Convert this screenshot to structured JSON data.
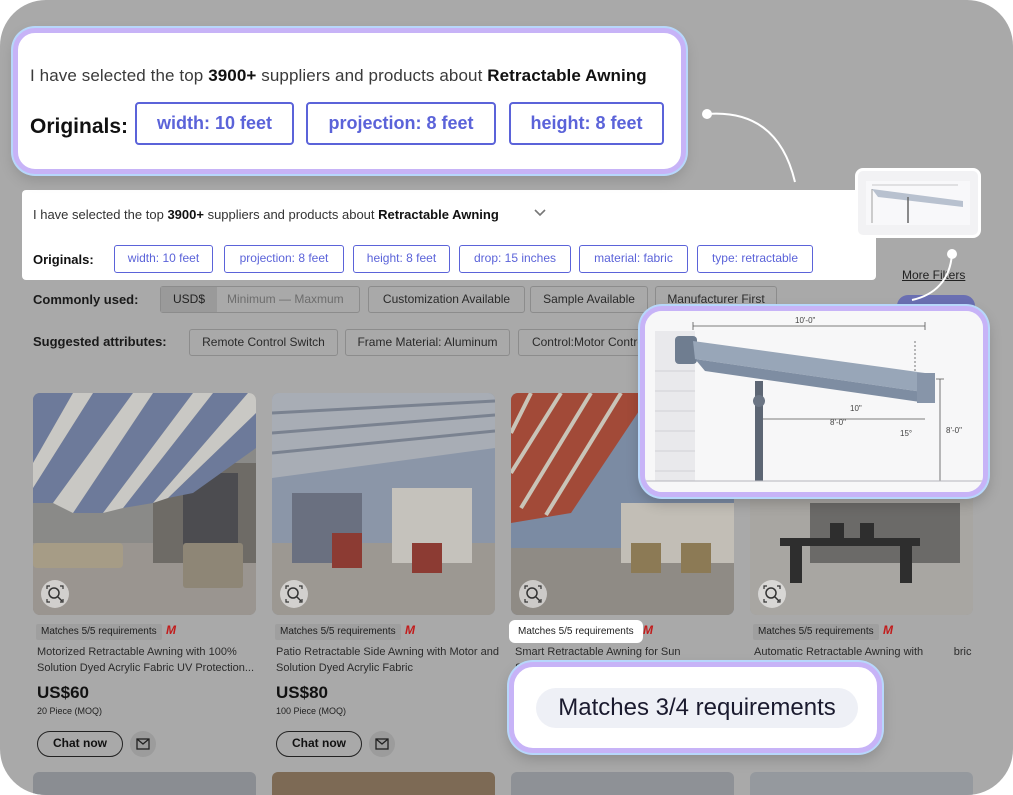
{
  "summary": {
    "prefix": "I have selected the top",
    "count": "3900+",
    "middle": "suppliers and products about",
    "query": "Retractable Awning"
  },
  "originals_label": "Originals:",
  "originals_top": [
    "width: 10 feet",
    "projection: 8 feet",
    "height: 8 feet"
  ],
  "originals_full": [
    "width: 10 feet",
    "projection: 8 feet",
    "height: 8 feet",
    "drop: 15 inches",
    "material: fabric",
    "type: retractable"
  ],
  "commonly_used": {
    "label": "Commonly used:",
    "currency": "USD$",
    "range_placeholder": "Minimum — Maxmum",
    "chips": [
      "Customization Available",
      "Sample Available",
      "Manufacturer First"
    ]
  },
  "suggested": {
    "label": "Suggested attributes:",
    "chips": [
      "Remote Control Switch",
      "Frame Material: Aluminum",
      "Control:Motor Contro"
    ]
  },
  "more_filters": "More Filters",
  "match_badge": "Matches 5/5 requirements",
  "match_callout": "Matches 3/4 requirements",
  "chat_label": "Chat now",
  "products": [
    {
      "title": "Motorized Retractable Awning with 100% Solution Dyed Acrylic Fabric UV Protection...",
      "price": "US$60",
      "moq": "20 Piece  (MOQ)"
    },
    {
      "title": "Patio Retractable Side Awning with Motor and Solution Dyed Acrylic Fabric",
      "price": "US$80",
      "moq": "100 Piece  (MOQ)"
    },
    {
      "title": "Smart Retractable Awning for Sun Shade S",
      "price": "",
      "moq": ""
    },
    {
      "title": "Automatic Retractable Awning with          bric",
      "price": "",
      "moq": ""
    }
  ],
  "diagram": {
    "dim_width": "10'-0\"",
    "dim_projection": "8'-0\"",
    "dim_height": "8'-0\"",
    "dim_drop": "10\"",
    "dim_angle": "15°"
  },
  "colors": {
    "accent": "#5b63d9",
    "glow_purple": "#c7b3f7",
    "glow_blue": "#b7d7fb",
    "dim_bg": "#a9a9a9",
    "logo_red": "#c21a1a"
  },
  "icons": [
    "chevron-down-icon",
    "visual-search-icon",
    "mail-icon",
    "supplier-logo-icon"
  ]
}
